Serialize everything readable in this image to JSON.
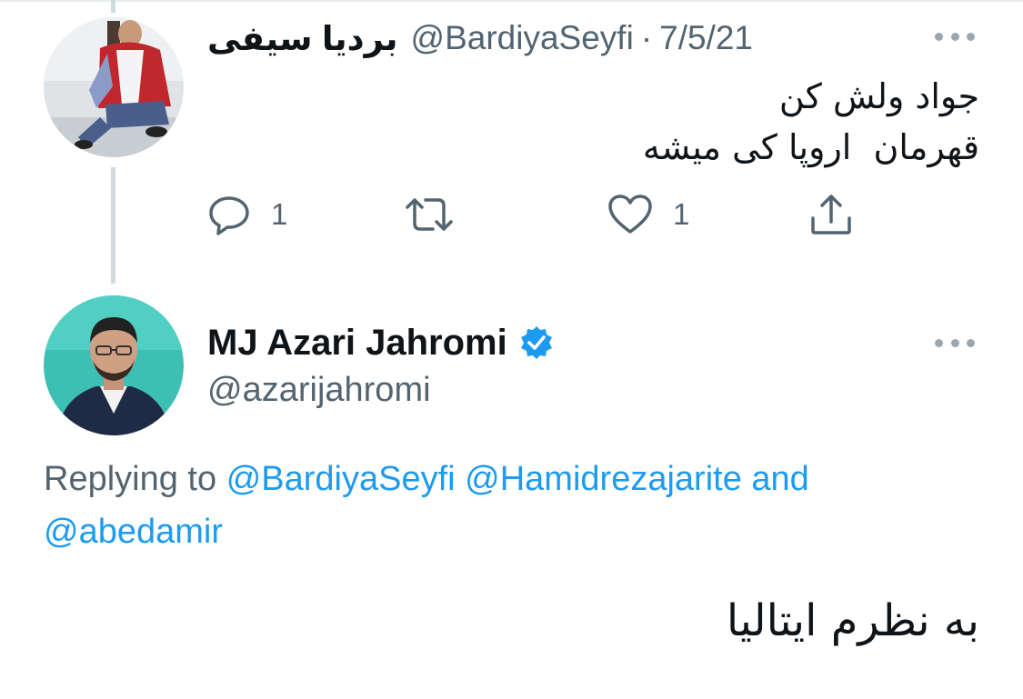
{
  "parent_tweet": {
    "display_name": "بردیا سیفی",
    "handle": "@BardiyaSeyfi",
    "separator": "·",
    "date": "7/5/21",
    "text_line_1": "جواد ولش کن",
    "text_line_2": "قهرمان  اروپا کی میشه",
    "actions": {
      "reply_icon": "reply-icon",
      "reply_count": "1",
      "retweet_icon": "retweet-icon",
      "like_icon": "heart-icon",
      "like_count": "1",
      "share_icon": "share-icon"
    }
  },
  "reply_tweet": {
    "display_name": "MJ Azari Jahromi",
    "verified_icon": "verified-badge-icon",
    "handle": "@azarijahromi",
    "replying_prefix": "Replying to",
    "mention_1": "@BardiyaSeyfi",
    "mention_2": "@Hamidrezajarite",
    "mention_and": "and",
    "mention_3": "@abedamir",
    "text": "به نظرم ایتالیا"
  },
  "colors": {
    "link": "#1d9bf0",
    "secondary_text": "#536471",
    "primary_text": "#0f1419",
    "thread_line": "#cfd9de",
    "verified": "#1d9bf0"
  }
}
